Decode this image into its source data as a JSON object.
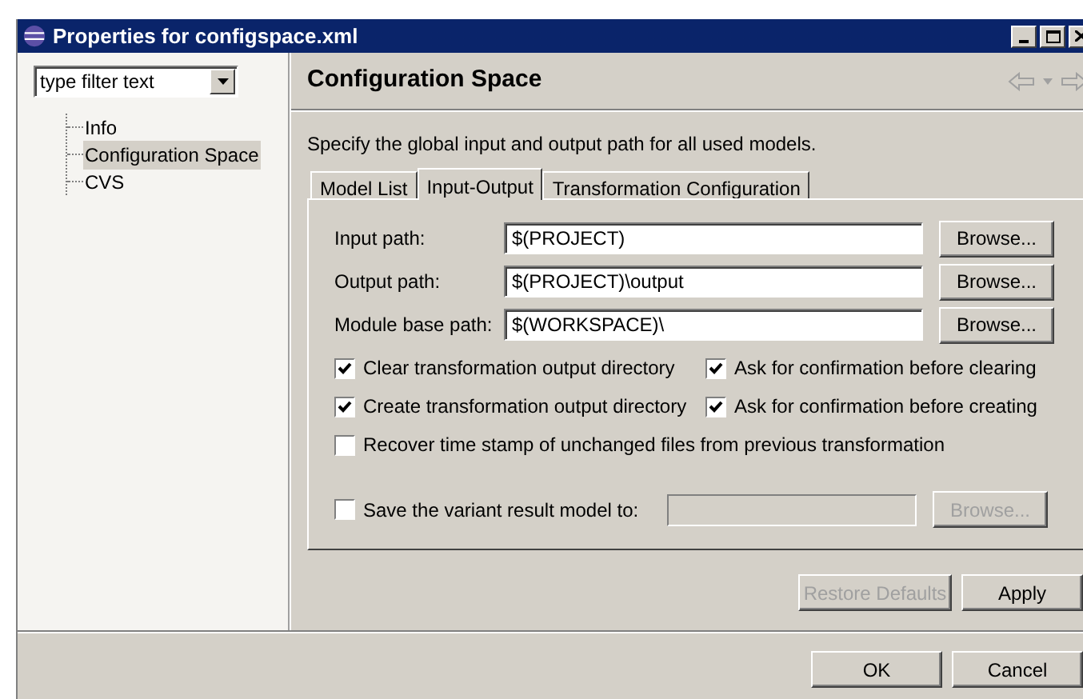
{
  "window": {
    "title": "Properties for configspace.xml"
  },
  "filter": {
    "placeholder": "type filter text"
  },
  "tree": [
    {
      "label": "Info",
      "selected": false
    },
    {
      "label": "Configuration Space",
      "selected": true
    },
    {
      "label": "CVS",
      "selected": false
    }
  ],
  "page": {
    "title": "Configuration Space",
    "description": "Specify the global input and output path for all used models."
  },
  "tabs": [
    {
      "label": "Model List",
      "selected": false
    },
    {
      "label": "Input-Output",
      "selected": true
    },
    {
      "label": "Transformation Configuration",
      "selected": false
    }
  ],
  "paths": [
    {
      "label": "Input path:",
      "value": "$(PROJECT)",
      "button": "Browse..."
    },
    {
      "label": "Output path:",
      "value": "$(PROJECT)\\output",
      "button": "Browse..."
    },
    {
      "label": "Module base path:",
      "value": "$(WORKSPACE)\\",
      "button": "Browse..."
    }
  ],
  "options": [
    [
      {
        "label": "Clear transformation output directory",
        "checked": true
      },
      {
        "label": "Ask for confirmation before clearing",
        "checked": true
      }
    ],
    [
      {
        "label": "Create transformation output directory",
        "checked": true
      },
      {
        "label": "Ask for confirmation before creating",
        "checked": true
      }
    ],
    [
      {
        "label": "Recover time stamp of unchanged files from previous transformation",
        "checked": false
      }
    ]
  ],
  "save_variant": {
    "label": "Save the variant result model to:",
    "checked": false,
    "disabled": true,
    "button": "Browse..."
  },
  "page_buttons": [
    {
      "label": "Restore Defaults",
      "disabled": true
    },
    {
      "label": "Apply",
      "disabled": false
    }
  ],
  "dialog_buttons": [
    "OK",
    "Cancel"
  ]
}
